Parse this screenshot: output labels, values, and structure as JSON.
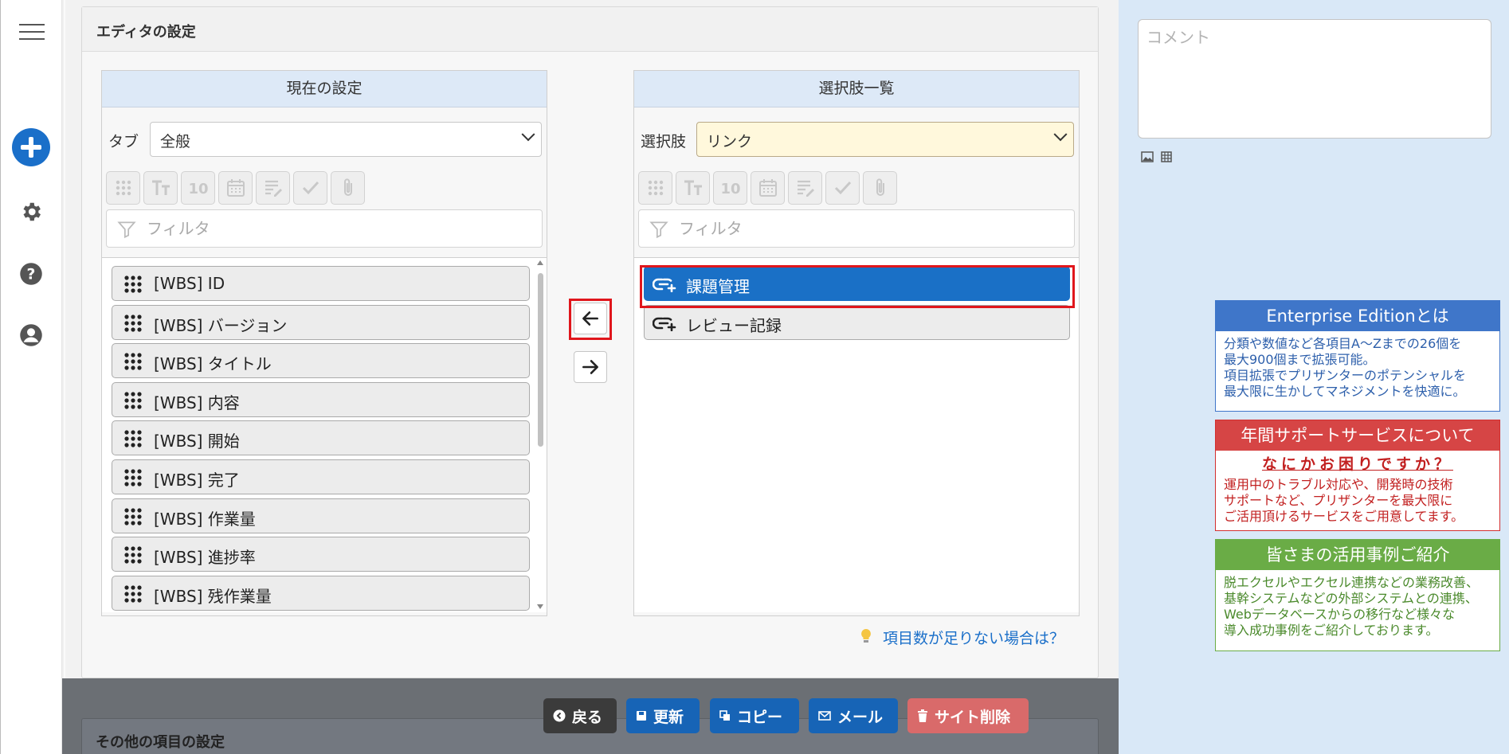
{
  "editor": {
    "title": "エディタの設定",
    "current": {
      "header": "現在の設定",
      "tab_label": "タブ",
      "tab_value": "全般",
      "filter_placeholder": "フィルタ",
      "items": [
        "[WBS] ID",
        "[WBS] バージョン",
        "[WBS] タイトル",
        "[WBS] 内容",
        "[WBS] 開始",
        "[WBS] 完了",
        "[WBS] 作業量",
        "[WBS] 進捗率",
        "[WBS] 残作業量"
      ]
    },
    "choices": {
      "header": "選択肢一覧",
      "select_label": "選択肢",
      "select_value": "リンク",
      "filter_placeholder": "フィルタ",
      "items": [
        "課題管理",
        "レビュー記録"
      ],
      "selected_index": 0
    },
    "tool_icons": [
      "grip-icon",
      "text-icon",
      "number-icon",
      "calendar-icon",
      "description-icon",
      "check-icon",
      "attachment-icon"
    ],
    "hint": "項目数が足りない場合は？"
  },
  "comment": {
    "placeholder": "コメント"
  },
  "promos": [
    {
      "title": "Enterprise Editionとは",
      "lines": [
        "分類や数値など各項目A～Zまでの26個を",
        "最大900個まで拡張可能。",
        "項目拡張でプリザンターのポテンシャルを",
        "最大限に生かしてマネジメントを快適に。"
      ]
    },
    {
      "title": "年間サポートサービスについて",
      "catch": "なにかお困りですか？",
      "lines": [
        "運用中のトラブル対応や、開発時の技術",
        "サポートなど、プリザンターを最大限に",
        "ご活用頂けるサービスをご用意してます。"
      ]
    },
    {
      "title": "皆さまの活用事例ご紹介",
      "lines": [
        "脱エクセルやエクセル連携などの業務改善、",
        "基幹システムなどの外部システムとの連携、",
        "Webデータベースからの移行など様々な",
        "導入成功事例をご紹介しております。"
      ]
    }
  ],
  "next_section": {
    "title": "その他の項目の設定"
  },
  "actions": {
    "back": "戻る",
    "update": "更新",
    "copy": "コピー",
    "mail": "メール",
    "delete": "サイト削除"
  },
  "colors": {
    "accent": "#1a70c6",
    "highlight_frame": "#e0161c",
    "delete": "#d96a6a"
  }
}
